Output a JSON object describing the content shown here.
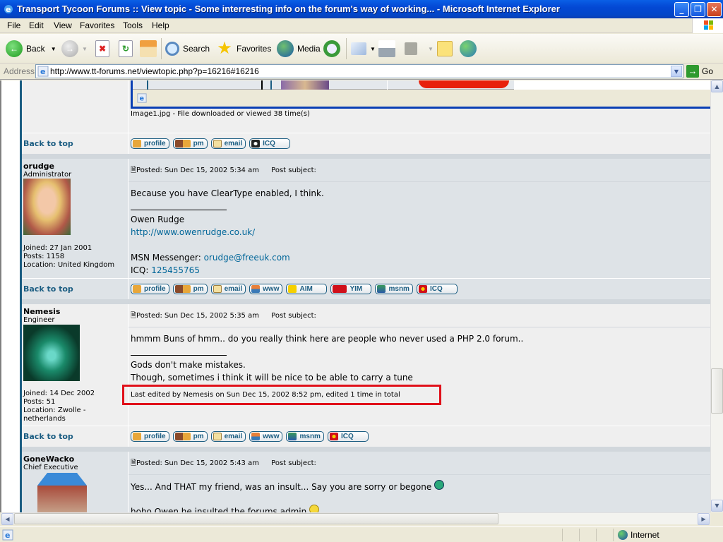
{
  "window": {
    "title": "Transport Tycoon Forums :: View topic - Some interresting info on the forum's way of working... - Microsoft Internet Explorer",
    "controls": {
      "minimize": "_",
      "restore": "❐",
      "close": "✕"
    }
  },
  "menu": [
    "File",
    "Edit",
    "View",
    "Favorites",
    "Tools",
    "Help"
  ],
  "toolbar": {
    "back": "Back",
    "search": "Search",
    "favorites": "Favorites",
    "media": "Media",
    "icons": [
      "back-icon",
      "forward-icon",
      "stop-icon",
      "refresh-icon",
      "home-icon",
      "search-icon",
      "favorites-icon",
      "media-icon",
      "history-icon",
      "mail-icon",
      "print-icon",
      "edit-icon",
      "discuss-icon",
      "messenger-icon"
    ]
  },
  "address": {
    "label": "Address",
    "url": "http://www.tt-forums.net/viewtopic.php?p=16216#16216",
    "go": "Go"
  },
  "attachment": {
    "caption": "Image1.jpg - File downloaded or viewed 38 time(s)"
  },
  "back_to_top": "Back to top",
  "buttons": {
    "profile": "profile",
    "pm": "pm",
    "email": "email",
    "www": "www",
    "aim": "AIM",
    "yim": "YIM",
    "msnm": "msnm",
    "icq": "ICQ"
  },
  "posts": [
    {
      "author": "orudge",
      "rank": "Administrator",
      "joined": "Joined: 27 Jan 2001",
      "posts": "Posts: 1158",
      "location": "Location: United Kingdom",
      "posted": "Posted: Sun Dec 15, 2002 5:34 am",
      "subject": "Post subject:",
      "body": "Because you have ClearType enabled, I think.",
      "signature": {
        "name": "Owen Rudge",
        "website": "http://www.owenrudge.co.uk/",
        "msn_label": "MSN Messenger: ",
        "msn": "orudge@freeuk.com",
        "icq_label": "ICQ: ",
        "icq": "125455765"
      }
    },
    {
      "author": "Nemesis",
      "rank": "Engineer",
      "joined": "Joined: 14 Dec 2002",
      "posts": "Posts: 51",
      "location": "Location: Zwolle -",
      "location2": "netherlands",
      "posted": "Posted: Sun Dec 15, 2002 5:35 am",
      "subject": "Post subject:",
      "body": "hmmm Buns of hmm.. do you really think here are people who never used a PHP 2.0 forum..",
      "signature": {
        "line1": "Gods don't make mistakes.",
        "line2": "Though, sometimes i think it will be nice to be able to carry a tune"
      },
      "edited": "Last edited by Nemesis on Sun Dec 15, 2002 8:52 pm, edited 1 time in total"
    },
    {
      "author": "GoneWacko",
      "rank": "Chief Executive",
      "posted": "Posted: Sun Dec 15, 2002 5:43 am",
      "subject": "Post subject:",
      "body": "Yes... And THAT my friend, was an insult... Say you are sorry or begone",
      "body2": "hoho Owen he insulted the forums admin"
    }
  ],
  "status": {
    "zone": "Internet"
  },
  "colors": {
    "accent": "#1b5d82",
    "row1": "#efefef",
    "row2": "#dee3e7",
    "highlight": "#e0101a"
  }
}
